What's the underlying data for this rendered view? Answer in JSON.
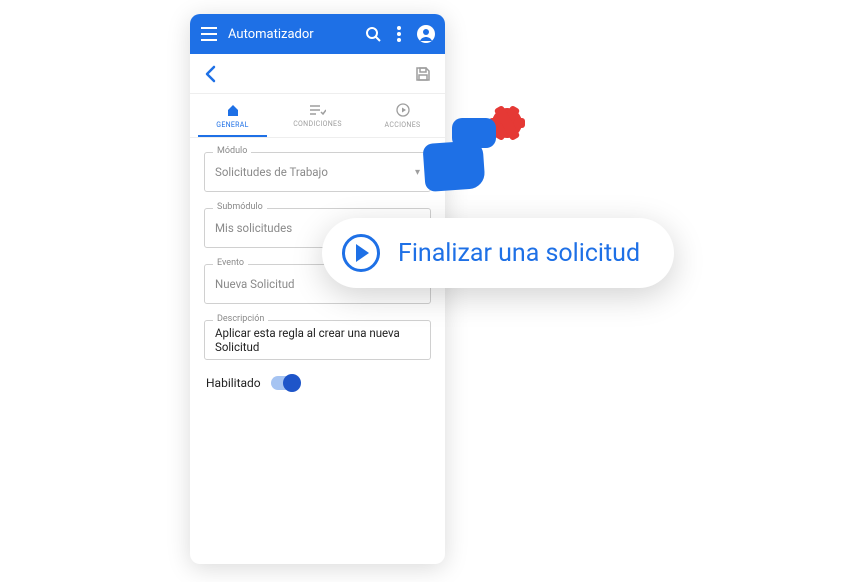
{
  "appbar": {
    "title": "Automatizador"
  },
  "tabs": {
    "general": "GENERAL",
    "condiciones": "CONDICIONES",
    "acciones": "ACCIONES"
  },
  "fields": {
    "modulo": {
      "label": "Módulo",
      "value": "Solicitudes de Trabajo"
    },
    "submodulo": {
      "label": "Submódulo",
      "value": "Mis solicitudes"
    },
    "evento": {
      "label": "Evento",
      "value": "Nueva Solicitud"
    },
    "descripcion": {
      "label": "Descripción",
      "value": "Aplicar esta regla al crear una nueva Solicitud"
    }
  },
  "toggle": {
    "label": "Habilitado",
    "on": true
  },
  "callout": {
    "text": "Finalizar una solicitud"
  }
}
